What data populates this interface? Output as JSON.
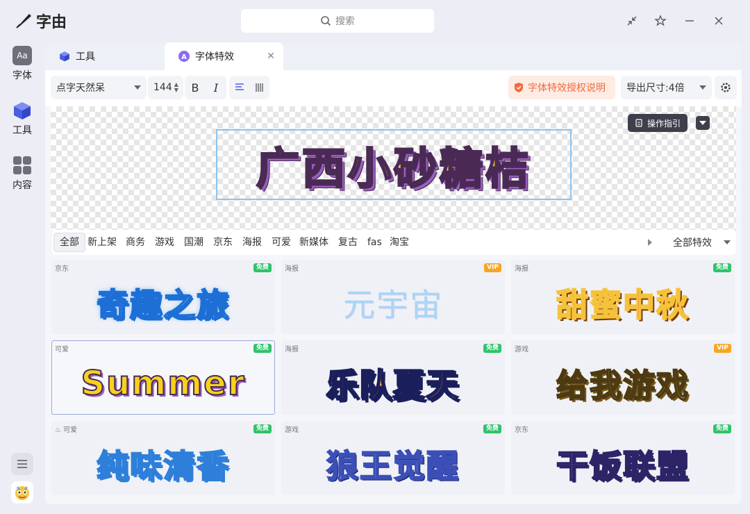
{
  "app": {
    "name": "字由"
  },
  "search": {
    "placeholder": "搜索"
  },
  "rail": [
    {
      "label": "字体",
      "icon": "font-aa-icon"
    },
    {
      "label": "工具",
      "icon": "cube-icon"
    },
    {
      "label": "内容",
      "icon": "grid-icon"
    }
  ],
  "tabs": [
    {
      "label": "工具",
      "icon": "cube-icon"
    },
    {
      "label": "字体特效",
      "icon": "effect-icon",
      "active": true
    }
  ],
  "toolbar": {
    "font_name": "点字天然呆",
    "font_size": "144",
    "bold": "B",
    "italic": "I",
    "license": "字体特效授权说明",
    "export": "导出尺寸:4倍"
  },
  "canvas": {
    "text": "广西小砂糖桔",
    "guide_label": "操作指引"
  },
  "filters": {
    "items": [
      "全部",
      "新上架",
      "商务",
      "游戏",
      "国潮",
      "京东",
      "海报",
      "可爱",
      "新媒体",
      "复古",
      "fas",
      "淘宝"
    ],
    "active_index": 0,
    "effect_select": "全部特效"
  },
  "cards": [
    {
      "tag": "京东",
      "badge": "免费",
      "text": "奇趣之旅"
    },
    {
      "tag": "海报",
      "badge": "VIP",
      "text": "元宇宙"
    },
    {
      "tag": "海报",
      "badge": "免费",
      "text": "甜蜜中秋"
    },
    {
      "tag": "可爱",
      "badge": "免费",
      "text": "Summer"
    },
    {
      "tag": "海报",
      "badge": "免费",
      "text": "乐队夏天"
    },
    {
      "tag": "游戏",
      "badge": "VIP",
      "text": "给我游戏"
    },
    {
      "tag": "可爱",
      "badge": "免费",
      "text": "纯味清香"
    },
    {
      "tag": "游戏",
      "badge": "免费",
      "text": "狼王觉醒"
    },
    {
      "tag": "京东",
      "badge": "免费",
      "text": "干饭联盟"
    }
  ],
  "colors": {
    "accent": "#5b6ee1",
    "free": "#2fc36b",
    "vip": "#f5a623",
    "license": "#f26b3a"
  }
}
